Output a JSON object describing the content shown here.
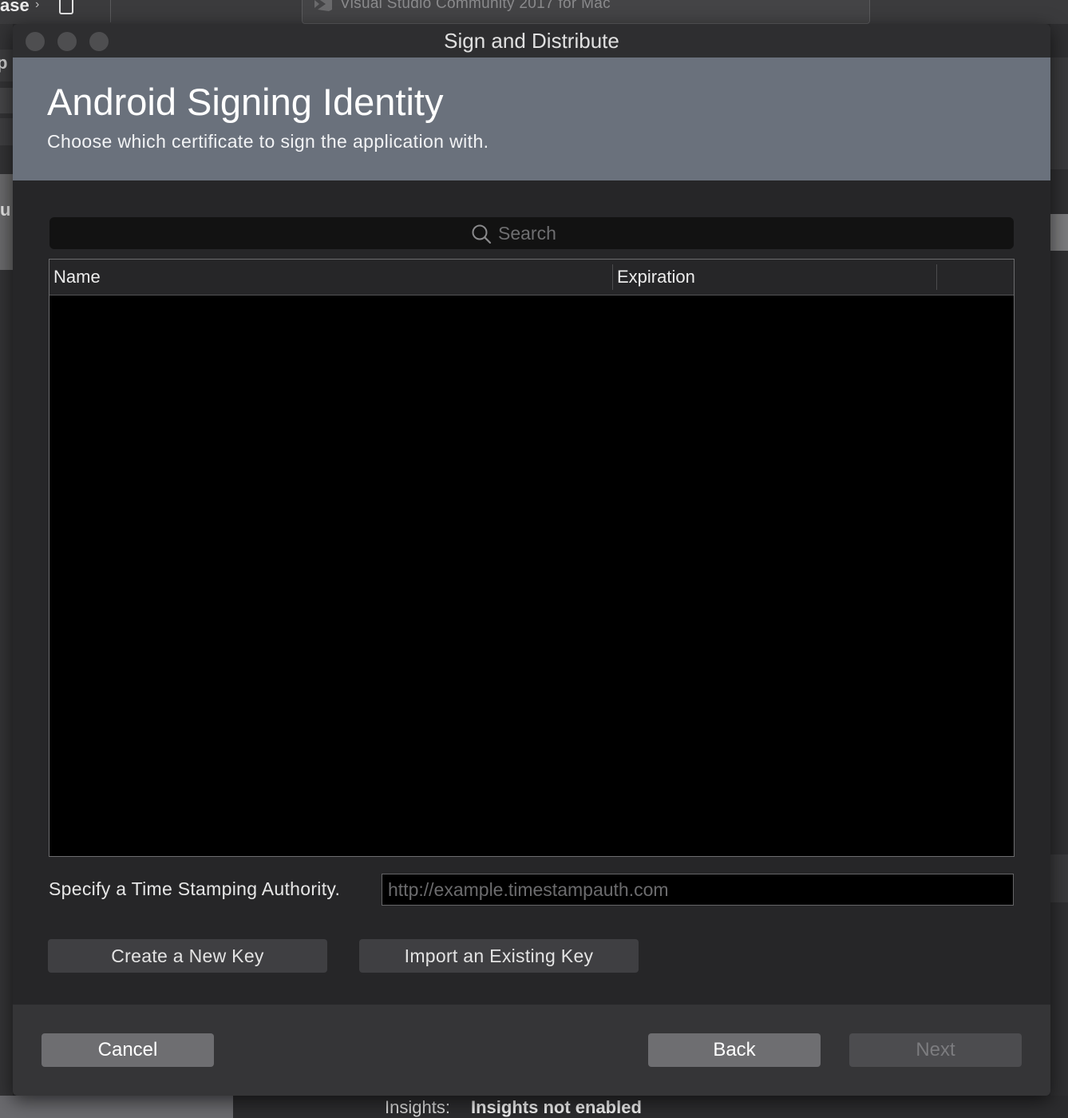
{
  "background": {
    "breadcrumb": "ase",
    "app_title": "Visual Studio Community 2017 for Mac",
    "left_glyph_1": "p",
    "left_glyph_2": "u",
    "insights_label": "Insights:",
    "insights_value": "Insights not enabled"
  },
  "dialog": {
    "window_title": "Sign and Distribute",
    "header": {
      "title": "Android Signing Identity",
      "subtitle": "Choose which certificate to sign the application with."
    },
    "search": {
      "placeholder": "Search",
      "value": ""
    },
    "table": {
      "columns": [
        "Name",
        "Expiration"
      ],
      "rows": []
    },
    "timestamp": {
      "label": "Specify a Time Stamping Authority.",
      "placeholder": "http://example.timestampauth.com",
      "value": ""
    },
    "buttons": {
      "create_key": "Create a New Key",
      "import_key": "Import an Existing Key"
    },
    "footer": {
      "cancel": "Cancel",
      "back": "Back",
      "next": "Next",
      "next_enabled": false
    }
  },
  "colors": {
    "header_bg": "#6a717c",
    "dialog_bg": "#262628",
    "footer_bg": "#353537",
    "button_bg": "#6e6e71",
    "disabled_button_bg": "#4c4c4f"
  }
}
